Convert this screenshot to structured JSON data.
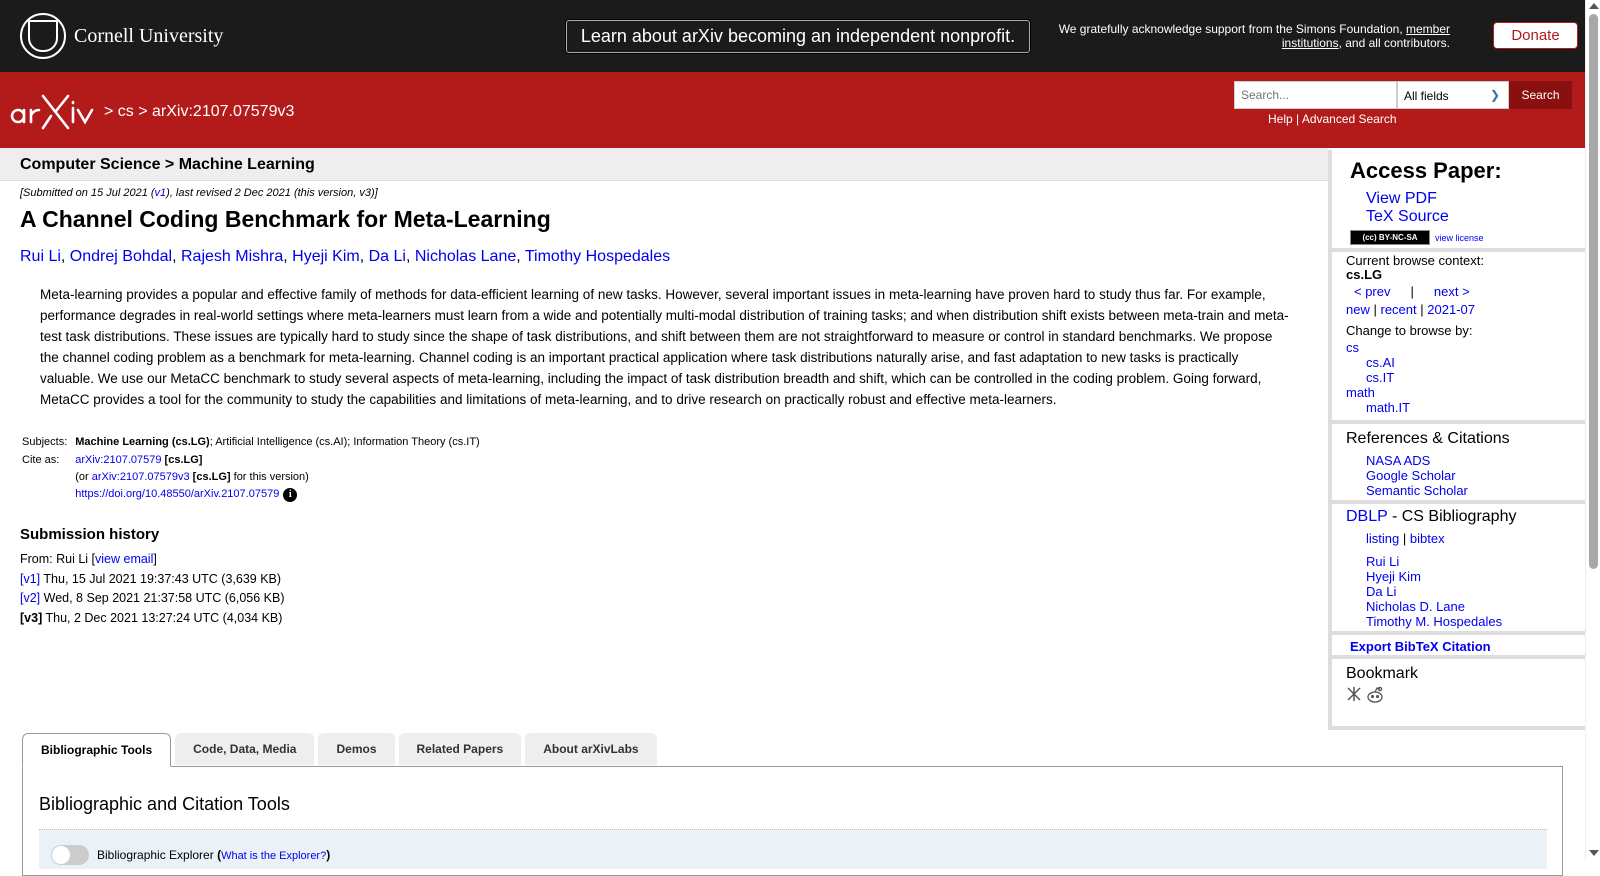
{
  "topbar": {
    "university": "Cornell University",
    "banner": "Learn about arXiv becoming an independent nonprofit.",
    "support_pre": "We gratefully acknowledge support from the Simons Foundation, ",
    "support_link1": "member",
    "support_link2": "institutions",
    "support_post": ", and all contributors.",
    "donate": "Donate"
  },
  "header": {
    "crumb_sep1": " > ",
    "crumb_cs": "cs",
    "crumb_sep2": " > ",
    "crumb_id": "arXiv:2107.07579v3",
    "search_placeholder": "Search...",
    "field_selected": "All fields",
    "search_button": "Search",
    "help": "Help",
    "advanced": "Advanced Search",
    "help_sep": " | "
  },
  "paper": {
    "category": "Computer Science > Machine Learning",
    "date_pre": "[Submitted on 15 Jul 2021 (",
    "date_v1": "v1",
    "date_post": "), last revised 2 Dec 2021 (this version, v3)]",
    "title": "A Channel Coding Benchmark for Meta-Learning",
    "authors": [
      "Rui Li",
      "Ondrej Bohdal",
      "Rajesh Mishra",
      "Hyeji Kim",
      "Da Li",
      "Nicholas Lane",
      "Timothy Hospedales"
    ],
    "abstract": "Meta-learning provides a popular and effective family of methods for data-efficient learning of new tasks. However, several important issues in meta-learning have proven hard to study thus far. For example, performance degrades in real-world settings where meta-learners must learn from a wide and potentially multi-modal distribution of training tasks; and when distribution shift exists between meta-train and meta-test task distributions. These issues are typically hard to study since the shape of task distributions, and shift between them are not straightforward to measure or control in standard benchmarks. We propose the channel coding problem as a benchmark for meta-learning. Channel coding is an important practical application where task distributions naturally arise, and fast adaptation to new tasks is practically valuable. We use our MetaCC benchmark to study several aspects of meta-learning, including the impact of task distribution breadth and shift, which can be controlled in the coding problem. Going forward, MetaCC provides a tool for the community to study the capabilities and limitations of meta-learning, and to drive research on practically robust and effective meta-learners.",
    "subjects_label": "Subjects:",
    "subjects_primary": "Machine Learning (cs.LG)",
    "subjects_rest": "; Artificial Intelligence (cs.AI); Information Theory (cs.IT)",
    "cite_label": "Cite as:",
    "cite_id": "arXiv:2107.07579",
    "cite_cat": "[cs.LG]",
    "cite2_pre": "(or ",
    "cite2_id": "arXiv:2107.07579v3",
    "cite2_cat": "[cs.LG]",
    "cite2_post": " for this version)",
    "doi": "https://doi.org/10.48550/arXiv.2107.07579",
    "info_glyph": "i"
  },
  "history": {
    "heading": "Submission history",
    "from_pre": "From: Rui Li [",
    "from_link": "view email",
    "from_post": "]",
    "versions": [
      {
        "label": "[v1]",
        "text": " Thu, 15 Jul 2021 19:37:43 UTC (3,639 KB)"
      },
      {
        "label": "[v2]",
        "text": " Wed, 8 Sep 2021 21:37:58 UTC (6,056 KB)"
      },
      {
        "label": "[v3]",
        "text": " Thu, 2 Dec 2021 13:27:24 UTC (4,034 KB)"
      }
    ]
  },
  "tabs": [
    "Bibliographic Tools",
    "Code, Data, Media",
    "Demos",
    "Related Papers",
    "About arXivLabs"
  ],
  "panel": {
    "title": "Bibliographic and Citation Tools",
    "explorer": "Bibliographic Explorer ",
    "explorer_open": "(",
    "explorer_link": "What is the Explorer?",
    "explorer_close": ")"
  },
  "sidebar": {
    "access_heading": "Access Paper:",
    "view_pdf": "View PDF",
    "tex_source": "TeX Source",
    "cc_badge": "(cc) BY-NC-SA",
    "view_license": "view license",
    "browse_context_label": "Current browse context:",
    "browse_context": "cs.LG",
    "prev": "< prev",
    "pipe": "|",
    "next": "next >",
    "new": "new",
    "recent": "recent",
    "month": "2021-07",
    "change_browse": "Change to browse by:",
    "browse_cats": [
      {
        "label": "cs",
        "indent": false
      },
      {
        "label": "cs.AI",
        "indent": true
      },
      {
        "label": "cs.IT",
        "indent": true
      },
      {
        "label": "math",
        "indent": false
      },
      {
        "label": "math.IT",
        "indent": true
      }
    ],
    "refs_heading": "References & Citations",
    "refs": [
      "NASA ADS",
      "Google Scholar",
      "Semantic Scholar"
    ],
    "dblp": "DBLP",
    "dblp_rest": " - CS Bibliography",
    "listing": "listing",
    "bibtex": "bibtex",
    "dblp_authors": [
      "Rui Li",
      "Hyeji Kim",
      "Da Li",
      "Nicholas D. Lane",
      "Timothy M. Hospedales"
    ],
    "export": "Export BibTeX Citation",
    "bookmark": "Bookmark"
  },
  "colors": {
    "brand_red": "#b31b1b",
    "topbar": "#1b1b1b",
    "link": "#0000ee"
  }
}
